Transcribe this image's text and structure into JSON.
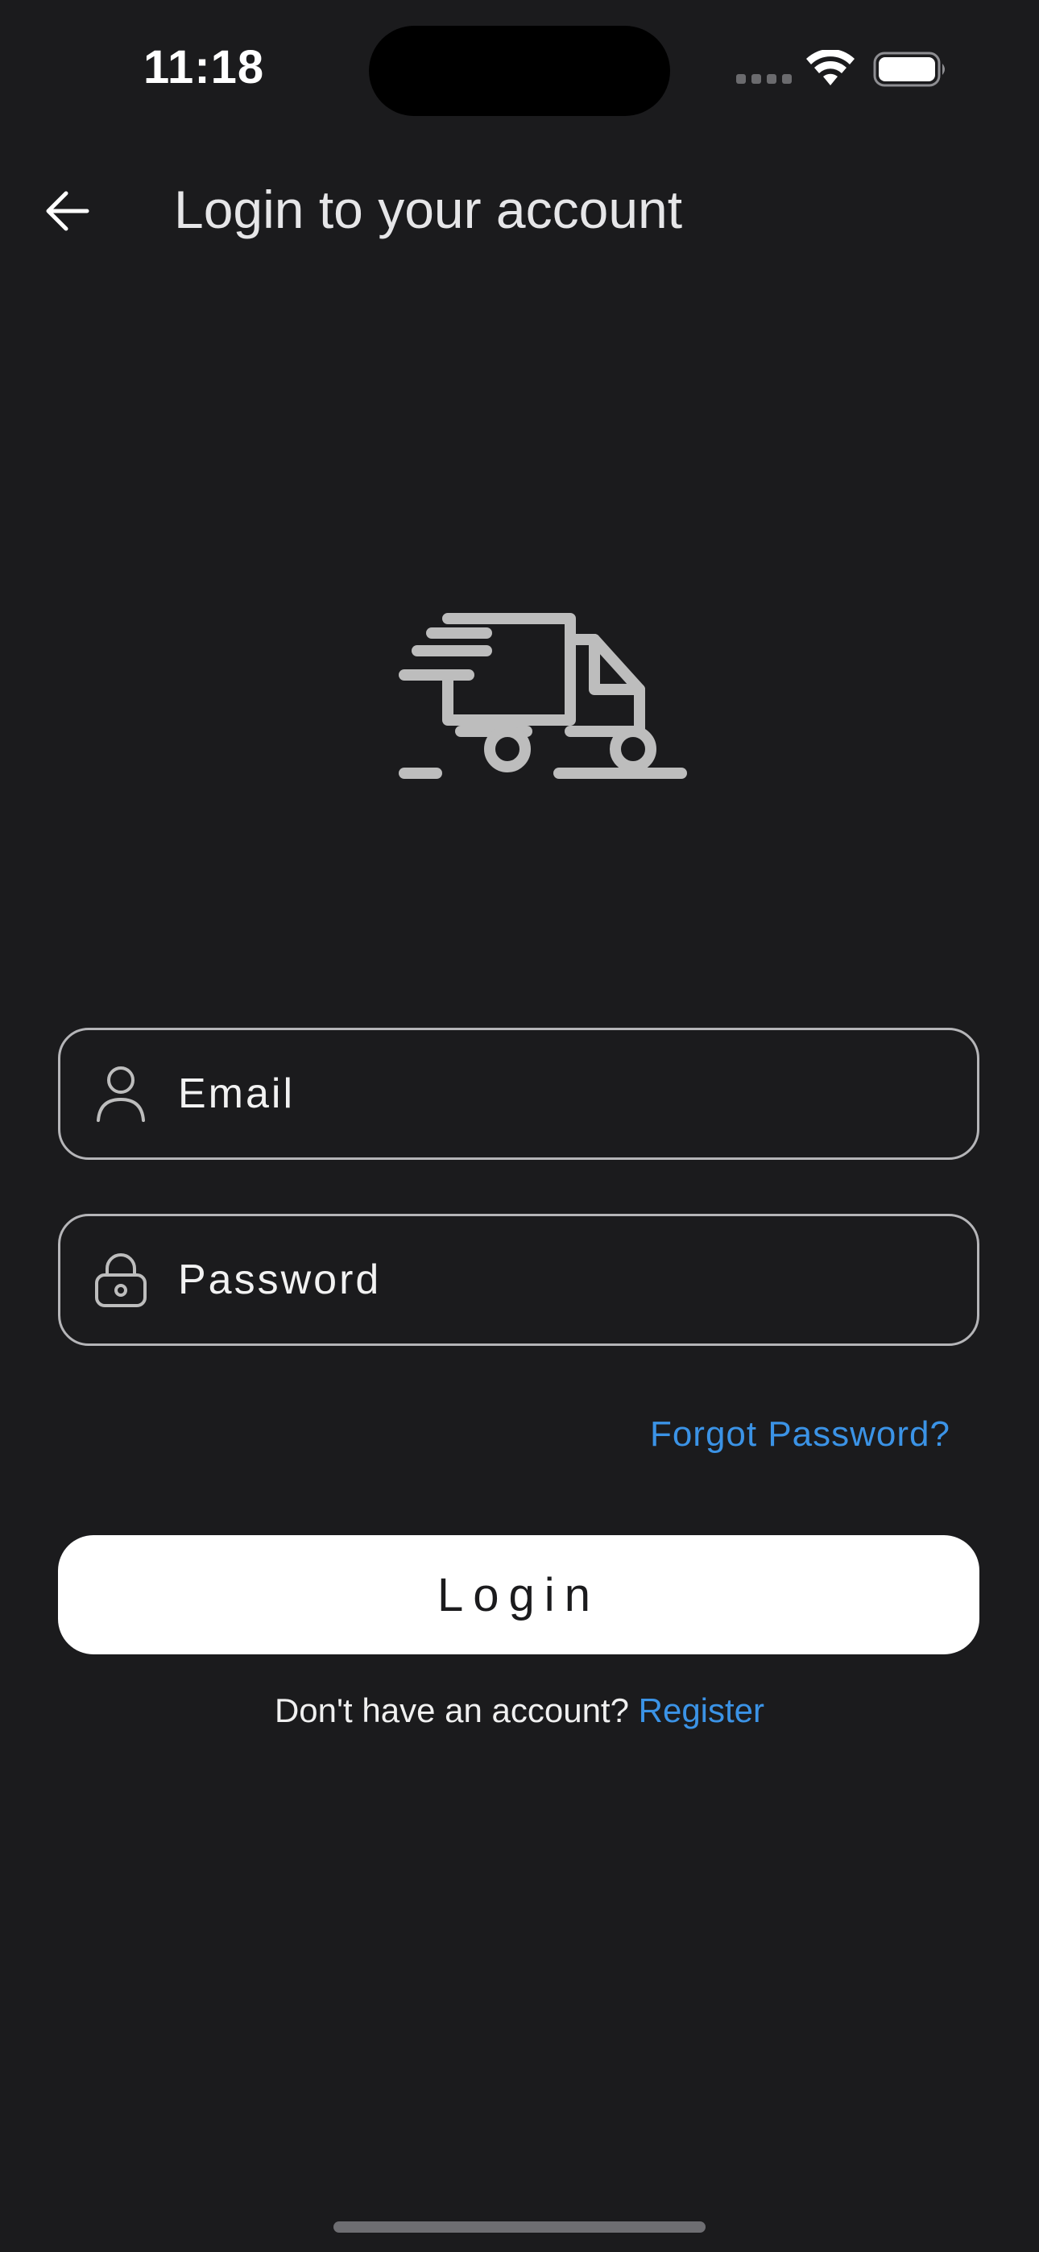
{
  "status_bar": {
    "time": "11:18"
  },
  "header": {
    "title": "Login to your account",
    "back_icon": "arrow-left-icon"
  },
  "illustration": {
    "icon": "delivery-truck-icon",
    "color": "#bdbdbd"
  },
  "form": {
    "email": {
      "placeholder": "Email",
      "value": "",
      "icon": "user-icon"
    },
    "password": {
      "placeholder": "Password",
      "value": "",
      "icon": "lock-icon"
    },
    "forgot_password": "Forgot Password?",
    "login_button": "Login"
  },
  "footer": {
    "prompt": "Don't have an account? ",
    "register_link": "Register"
  },
  "colors": {
    "background": "#1b1b1d",
    "link": "#3b93e6",
    "button_bg": "#ffffff",
    "field_border": "#b5b5b8"
  }
}
